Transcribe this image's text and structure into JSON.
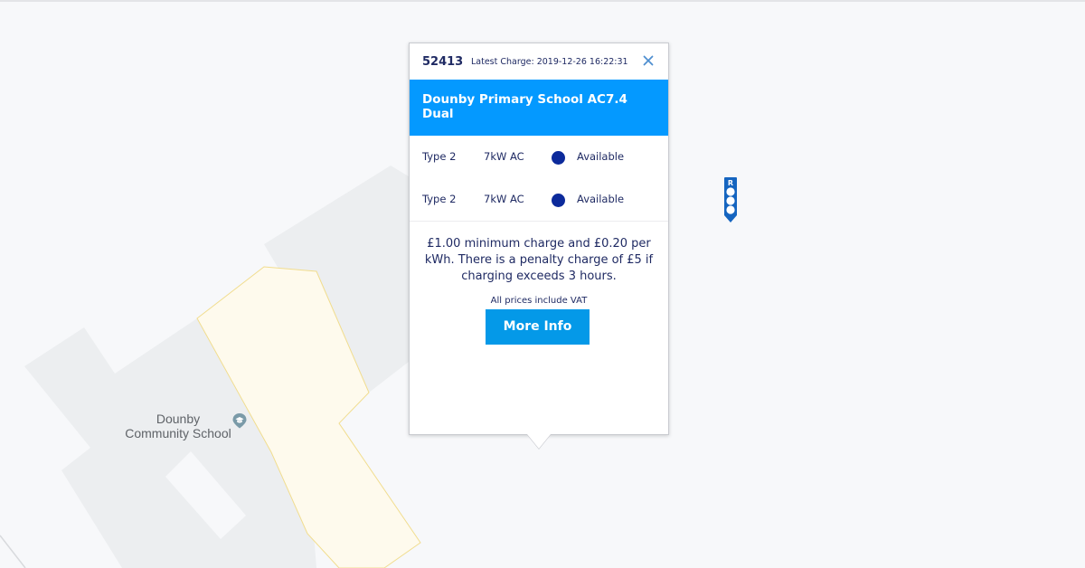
{
  "map": {
    "place_label_line1": "Dounby",
    "place_label_line2": "Community School",
    "place_icon": "school-pin-icon",
    "marker_letter": "R",
    "marker_icon": "charge-point-marker-icon"
  },
  "popup": {
    "charger_id": "52413",
    "latest_charge": "Latest Charge: 2019-12-26 16:22:31",
    "close_icon": "close-icon",
    "title": "Dounby Primary School AC7.4 Dual",
    "connectors": [
      {
        "type": "Type 2",
        "power": "7kW AC",
        "status": "Available",
        "status_color": "#0c2a9b"
      },
      {
        "type": "Type 2",
        "power": "7kW AC",
        "status": "Available",
        "status_color": "#0c2a9b"
      }
    ],
    "tariff": "£1.00 minimum charge and £0.20 per kWh. There is a penalty charge of £5 if charging exceeds 3 hours.",
    "vat_note": "All prices include VAT",
    "more_info_label": "More Info"
  },
  "colors": {
    "accent": "#0499ff",
    "button": "#0499e8",
    "text": "#1f2a63",
    "marker": "#1565c0"
  }
}
